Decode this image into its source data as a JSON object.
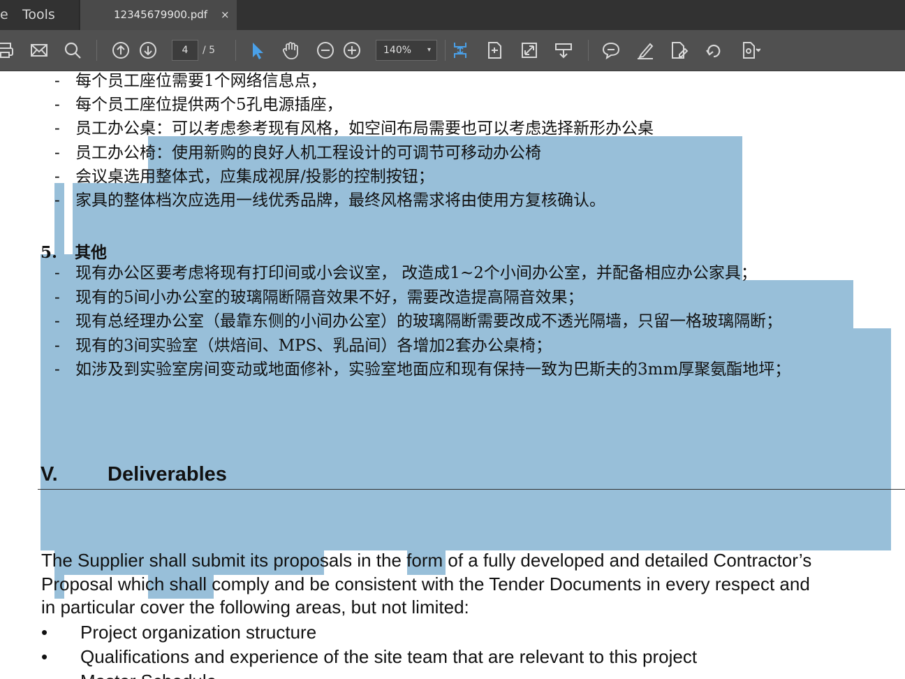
{
  "tabs": {
    "partial_label": "e",
    "tools_label": "Tools",
    "doc_label": "12345679900.pdf",
    "close_symbol": "×"
  },
  "toolbar": {
    "page_current": "4",
    "page_total": "/ 5",
    "zoom": "140%",
    "zoom_arrow": "▾"
  },
  "document": {
    "cn_lines": [
      "每个员工座位需要1个网络信息点，",
      "每个员工座位提供两个5孔电源插座，",
      "员工办公桌：可以考虑参考现有风格，如空间布局需要也可以考虑选择新形办公桌",
      "员工办公椅：使用新购的良好人机工程设计的可调节可移动办公椅",
      "会议桌选用整体式，应集成视屏/投影的控制按钮；",
      "家具的整体档次应选用一线优秀品牌，最终风格需求将由使用方复核确认。"
    ],
    "dash": "-",
    "section5_number": "5.",
    "section5_title": "其他",
    "other_lines": [
      "现有办公区要考虑将现有打印间或小会议室，  改造成1~2个小间办公室，并配备相应办公家具；",
      "现有的5间小办公室的玻璃隔断隔音效果不好，需要改造提高隔音效果；",
      "现有总经理办公室（最靠东侧的小间办公室）的玻璃隔断需要改成不透光隔墙，只留一格玻璃隔断；",
      "现有的3间实验室（烘焙间、MPS、乳品间）各增加2套办公桌椅；",
      "如涉及到实验室房间变动或地面修补，实验室地面应和现有保持一致为巴斯夫的3mm厚聚氨酯地坪；"
    ],
    "heading_number": "V.",
    "heading_title": "Deliverables",
    "para_lines": [
      "The Supplier shall submit its proposals in the form of a fully developed and detailed Contractor’s",
      "Proposal which shall comply and be consistent with the Tender Documents in every respect and",
      "in particular cover the following areas, but not limited:"
    ],
    "bullet_symbol": "•",
    "bullets": [
      "Project organization structure",
      "Qualifications and experience of the site team that are relevant to this project",
      "Master Schedule"
    ],
    "selection_color": "#98bfd9"
  }
}
